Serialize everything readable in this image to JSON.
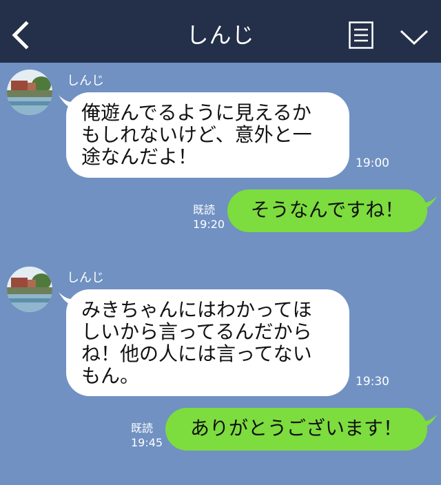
{
  "header": {
    "title": "しんじ",
    "back_icon": "chevron-left-icon",
    "menu_icon": "menu-icon",
    "collapse_icon": "chevron-down-icon",
    "bar_color": "#243049"
  },
  "chat": {
    "background": "#7091c2",
    "incoming_bubble_color": "#ffffff",
    "outgoing_bubble_color": "#7ddc3e",
    "messages": [
      {
        "sender": "しんじ",
        "text": "俺遊んでるように見えるか\nもしれないけど、意外と一\n途なんだよ！",
        "time": "19:00"
      },
      {
        "read_label": "既読",
        "time": "19:20",
        "text": "そうなんですね！"
      },
      {
        "sender": "しんじ",
        "text": "みきちゃんにはわかってほ\nしいから言ってるんだから\nね！他の人には言ってない\nもん。",
        "time": "19:30"
      },
      {
        "read_label": "既読",
        "time": "19:45",
        "text": "ありがとうございます！"
      }
    ]
  }
}
